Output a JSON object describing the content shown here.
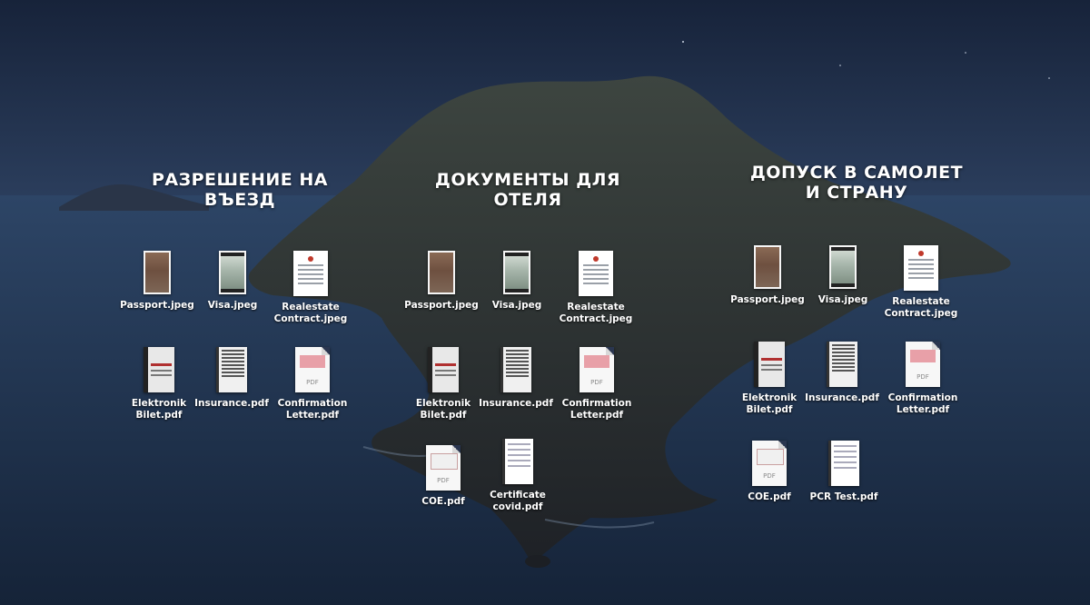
{
  "colors": {
    "sky_top": "#1a2740",
    "sea": "#22344f",
    "island": "#2b2f36",
    "text": "#ffffff"
  },
  "groups": [
    {
      "title": "РАЗРЕШЕНИЕ НА\nВЪЕЗД",
      "files": [
        {
          "label": "Passport.jpeg",
          "icon": "passport-photo-icon"
        },
        {
          "label": "Visa.jpeg",
          "icon": "visa-photo-icon"
        },
        {
          "label": "Realestate\nContract.jpeg",
          "icon": "document-photo-icon"
        },
        {
          "label": "Elektronik\nBilet.pdf",
          "icon": "ticket-pdf-icon"
        },
        {
          "label": "Insurance.pdf",
          "icon": "table-pdf-icon"
        },
        {
          "label": "Confirmation\nLetter.pdf",
          "icon": "pdf-file-icon"
        }
      ]
    },
    {
      "title": "ДОКУМЕНТЫ ДЛЯ\nОТЕЛЯ",
      "files": [
        {
          "label": "Passport.jpeg",
          "icon": "passport-photo-icon"
        },
        {
          "label": "Visa.jpeg",
          "icon": "visa-photo-icon"
        },
        {
          "label": "Realestate\nContract.jpeg",
          "icon": "document-photo-icon"
        },
        {
          "label": "Elektronik\nBilet.pdf",
          "icon": "ticket-pdf-icon"
        },
        {
          "label": "Insurance.pdf",
          "icon": "table-pdf-icon"
        },
        {
          "label": "Confirmation\nLetter.pdf",
          "icon": "pdf-file-icon"
        },
        {
          "label": "COE.pdf",
          "icon": "coe-pdf-icon"
        },
        {
          "label": "Certificate\ncovid.pdf",
          "icon": "certificate-pdf-icon"
        }
      ]
    },
    {
      "title": "ДОПУСК В САМОЛЕТ\nИ СТРАНУ",
      "files": [
        {
          "label": "Passport.jpeg",
          "icon": "passport-photo-icon"
        },
        {
          "label": "Visa.jpeg",
          "icon": "visa-photo-icon"
        },
        {
          "label": "Realestate\nContract.jpeg",
          "icon": "document-photo-icon"
        },
        {
          "label": "Elektronik\nBilet.pdf",
          "icon": "ticket-pdf-icon"
        },
        {
          "label": "Insurance.pdf",
          "icon": "table-pdf-icon"
        },
        {
          "label": "Confirmation\nLetter.pdf",
          "icon": "pdf-file-icon"
        },
        {
          "label": "COE.pdf",
          "icon": "coe-pdf-icon"
        },
        {
          "label": "PCR Test.pdf",
          "icon": "pcr-pdf-icon"
        }
      ]
    }
  ],
  "pdf_badge": "PDF"
}
